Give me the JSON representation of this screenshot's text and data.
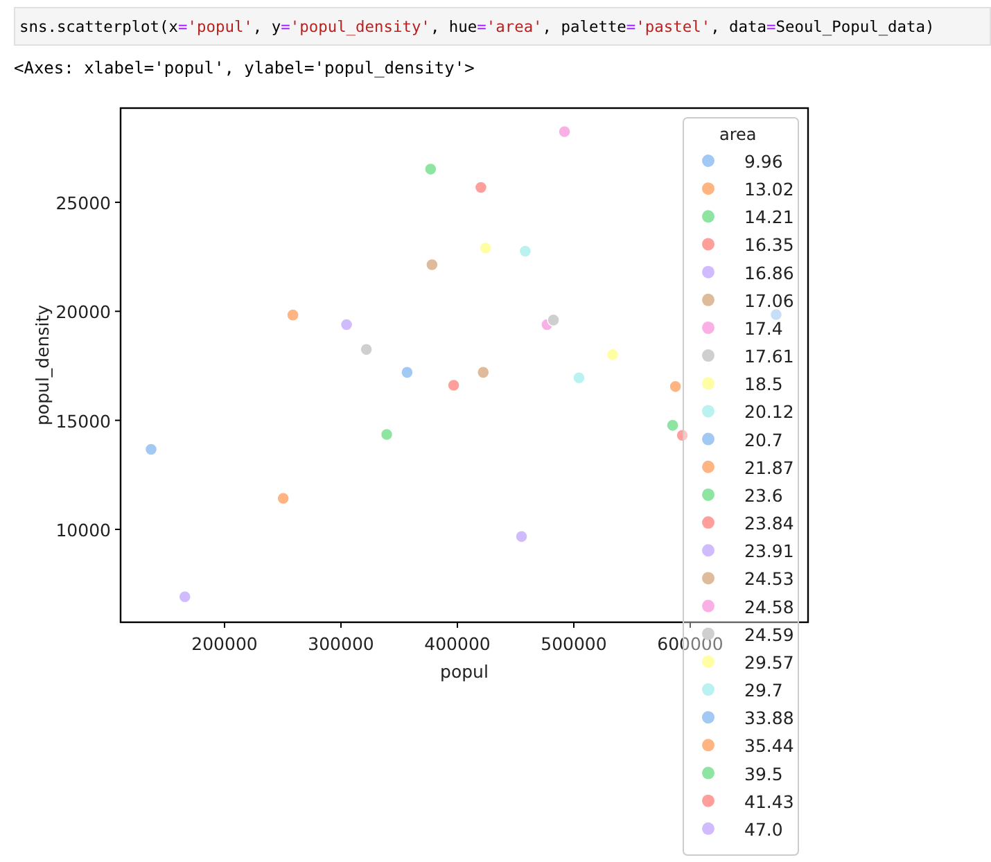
{
  "code_cell": {
    "tokens": [
      {
        "kind": "plain",
        "text": "sns.scatterplot(x"
      },
      {
        "kind": "op",
        "text": "="
      },
      {
        "kind": "string",
        "text": "'popul'"
      },
      {
        "kind": "plain",
        "text": ", y"
      },
      {
        "kind": "op",
        "text": "="
      },
      {
        "kind": "string",
        "text": "'popul_density'"
      },
      {
        "kind": "plain",
        "text": ", hue"
      },
      {
        "kind": "op",
        "text": "="
      },
      {
        "kind": "string",
        "text": "'area'"
      },
      {
        "kind": "plain",
        "text": ", palette"
      },
      {
        "kind": "op",
        "text": "="
      },
      {
        "kind": "string",
        "text": "'pastel'"
      },
      {
        "kind": "plain",
        "text": ", data"
      },
      {
        "kind": "op",
        "text": "="
      },
      {
        "kind": "plain",
        "text": "Seoul_Popul_data)"
      }
    ]
  },
  "output": {
    "text": "<Axes: xlabel='popul', ylabel='popul_density'>"
  },
  "chart": {
    "chart_data": {
      "type": "scatter",
      "xlabel": "popul",
      "ylabel": "popul_density",
      "legend": {
        "title": "area"
      },
      "xlim": [
        110700,
        701200
      ],
      "ylim": [
        5740,
        29320
      ],
      "xticks": [
        200000,
        300000,
        400000,
        500000,
        600000
      ],
      "yticks": [
        10000,
        15000,
        20000,
        25000
      ],
      "series": [
        {
          "name": "9.96",
          "color": "#a1c9f4",
          "x": [
            136900
          ],
          "values": [
            13670
          ]
        },
        {
          "name": "13.02",
          "color": "#ffb482",
          "x": [
            250400
          ],
          "values": [
            11420
          ]
        },
        {
          "name": "14.21",
          "color": "#8de5a1",
          "x": [
            339300
          ],
          "values": [
            14350
          ]
        },
        {
          "name": "16.35",
          "color": "#ff9f9b",
          "x": [
            396800
          ],
          "values": [
            16610
          ]
        },
        {
          "name": "16.86",
          "color": "#d0bbff",
          "x": [
            165900
          ],
          "values": [
            6910
          ]
        },
        {
          "name": "17.06",
          "color": "#debb9b",
          "x": [
            378200
          ],
          "values": [
            22140
          ]
        },
        {
          "name": "17.4",
          "color": "#fab0e4",
          "x": [
            477000
          ],
          "values": [
            19390
          ]
        },
        {
          "name": "17.61",
          "color": "#cfcfcf",
          "x": [
            321800
          ],
          "values": [
            18250
          ]
        },
        {
          "name": "18.5",
          "color": "#fffea3",
          "x": [
            424200
          ],
          "values": [
            22900
          ]
        },
        {
          "name": "20.12",
          "color": "#b9f2f0",
          "x": [
            458300
          ],
          "values": [
            22760
          ]
        },
        {
          "name": "20.7",
          "color": "#a1c9f4",
          "x": [
            356800
          ],
          "values": [
            17200
          ]
        },
        {
          "name": "21.87",
          "color": "#ffb482",
          "x": [
            258700
          ],
          "values": [
            19830
          ]
        },
        {
          "name": "23.6",
          "color": "#8de5a1",
          "x": [
            377000
          ],
          "values": [
            26520
          ]
        },
        {
          "name": "23.84",
          "color": "#ff9f9b",
          "x": [
            420200
          ],
          "values": [
            25680
          ]
        },
        {
          "name": "23.91",
          "color": "#d0bbff",
          "x": [
            304800
          ],
          "values": [
            19390
          ]
        },
        {
          "name": "24.53",
          "color": "#debb9b",
          "x": [
            422200
          ],
          "values": [
            17200
          ]
        },
        {
          "name": "24.58",
          "color": "#fab0e4",
          "x": [
            492000
          ],
          "values": [
            28240
          ]
        },
        {
          "name": "24.59",
          "color": "#cfcfcf",
          "x": [
            482500
          ],
          "values": [
            19600
          ]
        },
        {
          "name": "29.57",
          "color": "#fffea3",
          "x": [
            533300
          ],
          "values": [
            18010
          ]
        },
        {
          "name": "29.7",
          "color": "#b9f2f0",
          "x": [
            504400
          ],
          "values": [
            16950
          ]
        },
        {
          "name": "33.88",
          "color": "#a1c9f4",
          "x": [
            673800
          ],
          "values": [
            19850
          ]
        },
        {
          "name": "35.44",
          "color": "#ffb482",
          "x": [
            587300
          ],
          "values": [
            16550
          ]
        },
        {
          "name": "39.5",
          "color": "#8de5a1",
          "x": [
            584900
          ],
          "values": [
            14770
          ]
        },
        {
          "name": "41.43",
          "color": "#ff9f9b",
          "x": [
            593200
          ],
          "values": [
            14310
          ]
        },
        {
          "name": "47.0",
          "color": "#d0bbff",
          "x": [
            455100
          ],
          "values": [
            9670
          ]
        }
      ]
    }
  }
}
